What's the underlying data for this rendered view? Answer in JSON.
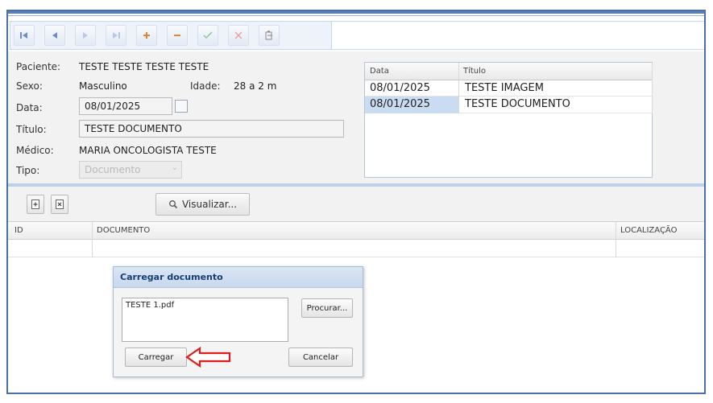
{
  "toolbar": {
    "buttons": [
      {
        "icon": "first-record-icon"
      },
      {
        "icon": "previous-record-icon"
      },
      {
        "icon": "next-record-icon"
      },
      {
        "icon": "last-record-icon"
      },
      {
        "icon": "add-icon"
      },
      {
        "icon": "remove-icon"
      },
      {
        "icon": "confirm-check-icon"
      },
      {
        "icon": "cancel-x-icon"
      },
      {
        "icon": "edit-document-icon"
      }
    ]
  },
  "form": {
    "paciente_label": "Paciente:",
    "paciente_value": "TESTE TESTE TESTE TESTE",
    "sexo_label": "Sexo:",
    "sexo_value": "Masculino",
    "idade_label": "Idade:",
    "idade_value": "28 a 2 m",
    "data_label": "Data:",
    "data_value": "08/01/2025",
    "titulo_label": "Título:",
    "titulo_value": "TESTE DOCUMENTO",
    "medico_label": "Médico:",
    "medico_value": "MARIA ONCOLOGISTA TESTE",
    "tipo_label": "Tipo:",
    "tipo_value": "Documento"
  },
  "records_grid": {
    "columns": [
      "Data",
      "Título"
    ],
    "rows": [
      {
        "data": "08/01/2025",
        "titulo": "TESTE IMAGEM",
        "selected": false
      },
      {
        "data": "08/01/2025",
        "titulo": "TESTE DOCUMENTO",
        "selected": true
      }
    ]
  },
  "files_toolbar": {
    "visualizar_label": "Visualizar..."
  },
  "files_grid": {
    "columns": [
      "ID",
      "DOCUMENTO",
      "LOCALIZAÇÃO"
    ]
  },
  "upload_dialog": {
    "title": "Carregar documento",
    "file_name": "TESTE 1.pdf",
    "browse_label": "Procurar...",
    "upload_label": "Carregar",
    "cancel_label": "Cancelar"
  },
  "colors": {
    "frame_border": "#4a6fa5",
    "nav_blue": "#6d8ccf",
    "add_orange": "#e7832f",
    "remove_orange": "#e7832f",
    "confirm_green": "#9cc79a",
    "cancel_red": "#e7a0a0",
    "selected_row": "#c9dcf2",
    "dialog_title": "#153d73",
    "annotation_arrow": "#e01b1b"
  }
}
